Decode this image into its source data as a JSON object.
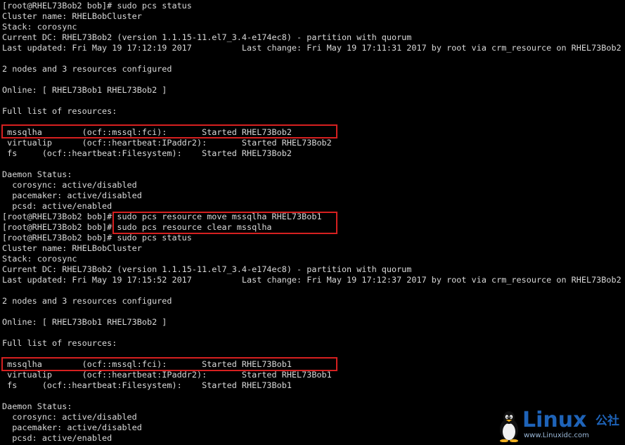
{
  "terminal": {
    "lines": [
      "[root@RHEL73Bob2 bob]# sudo pcs status",
      "Cluster name: RHELBobCluster",
      "Stack: corosync",
      "Current DC: RHEL73Bob2 (version 1.1.15-11.el7_3.4-e174ec8) - partition with quorum",
      "Last updated: Fri May 19 17:12:19 2017          Last change: Fri May 19 17:11:31 2017 by root via crm_resource on RHEL73Bob2",
      "",
      "2 nodes and 3 resources configured",
      "",
      "Online: [ RHEL73Bob1 RHEL73Bob2 ]",
      "",
      "Full list of resources:",
      "",
      " mssqlha        (ocf::mssql:fci):       Started RHEL73Bob2",
      " virtualip      (ocf::heartbeat:IPaddr2):       Started RHEL73Bob2",
      " fs     (ocf::heartbeat:Filesystem):    Started RHEL73Bob2",
      "",
      "Daemon Status:",
      "  corosync: active/disabled",
      "  pacemaker: active/disabled",
      "  pcsd: active/enabled",
      "[root@RHEL73Bob2 bob]# sudo pcs resource move mssqlha RHEL73Bob1",
      "[root@RHEL73Bob2 bob]# sudo pcs resource clear mssqlha",
      "[root@RHEL73Bob2 bob]# sudo pcs status",
      "Cluster name: RHELBobCluster",
      "Stack: corosync",
      "Current DC: RHEL73Bob2 (version 1.1.15-11.el7_3.4-e174ec8) - partition with quorum",
      "Last updated: Fri May 19 17:15:52 2017          Last change: Fri May 19 17:12:37 2017 by root via crm_resource on RHEL73Bob2",
      "",
      "2 nodes and 3 resources configured",
      "",
      "Online: [ RHEL73Bob1 RHEL73Bob2 ]",
      "",
      "Full list of resources:",
      "",
      " mssqlha        (ocf::mssql:fci):       Started RHEL73Bob1",
      " virtualip      (ocf::heartbeat:IPaddr2):       Started RHEL73Bob1",
      " fs     (ocf::heartbeat:Filesystem):    Started RHEL73Bob1",
      "",
      "Daemon Status:",
      "  corosync: active/disabled",
      "  pacemaker: active/disabled",
      "  pcsd: active/enabled"
    ]
  },
  "watermark": {
    "brand": "Linux",
    "brand_cn": "公社",
    "url": "www.Linuxidc.com"
  },
  "colors": {
    "background": "#000000",
    "text": "#d9d9d9",
    "highlight": "#d62020",
    "brand": "#1e63b8"
  }
}
